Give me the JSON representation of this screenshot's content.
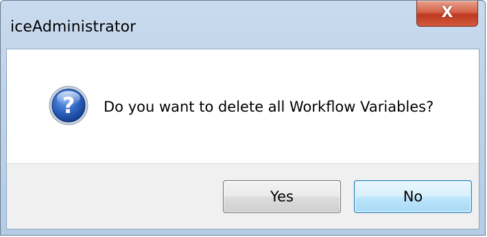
{
  "window": {
    "title": "iceAdministrator",
    "close_glyph": "X"
  },
  "dialog": {
    "icon": "question-icon",
    "icon_glyph": "?",
    "message": "Do you want to delete all Workflow Variables?",
    "buttons": {
      "yes_label": "Yes",
      "no_label": "No"
    }
  },
  "colors": {
    "titlebar": "#bdd3ea",
    "close_button": "#c0391f",
    "icon_blue": "#1f4fa8",
    "footer": "#f0f0f0",
    "default_button_border": "#3c7fb1"
  }
}
